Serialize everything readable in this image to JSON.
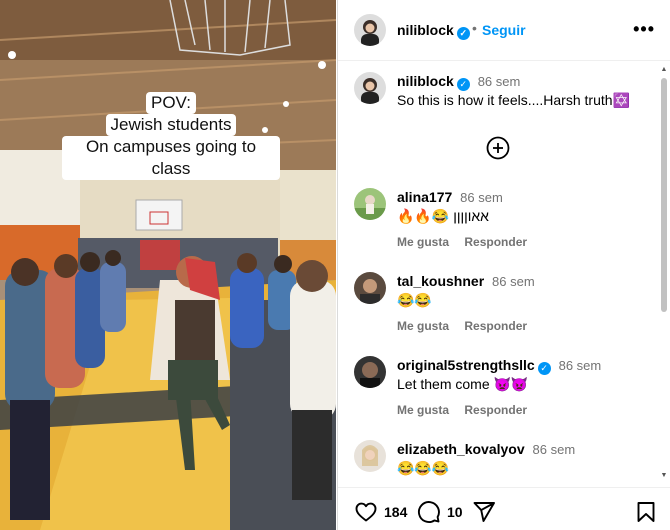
{
  "media": {
    "caption_lines": [
      "POV:",
      "Jewish students",
      "On campuses going to class"
    ]
  },
  "header": {
    "username": "niliblock",
    "separator": "•",
    "follow_label": "Seguir",
    "more_icon": "more-horizontal-icon"
  },
  "post": {
    "username": "niliblock",
    "time": "86 sem",
    "caption": "So this is how it feels....Harsh truth",
    "caption_emoji": "✡️"
  },
  "comments": [
    {
      "username": "alina177",
      "verified": false,
      "time": "86 sem",
      "text": "🔥🔥😂 אאוןןןן",
      "like_label": "Me gusta",
      "reply_label": "Responder"
    },
    {
      "username": "tal_koushner",
      "verified": false,
      "time": "86 sem",
      "text": "😂😂",
      "like_label": "Me gusta",
      "reply_label": "Responder"
    },
    {
      "username": "original5strengthsllc",
      "verified": true,
      "time": "86 sem",
      "text": "Let them come 👿👿",
      "like_label": "Me gusta",
      "reply_label": "Responder"
    },
    {
      "username": "elizabeth_kovalyov",
      "verified": false,
      "time": "86 sem",
      "text": "😂😂😂",
      "like_label": "",
      "reply_label": ""
    }
  ],
  "actions": {
    "likes": "184",
    "comments": "10"
  },
  "colors": {
    "accent": "#0095f6",
    "muted": "#737373"
  }
}
